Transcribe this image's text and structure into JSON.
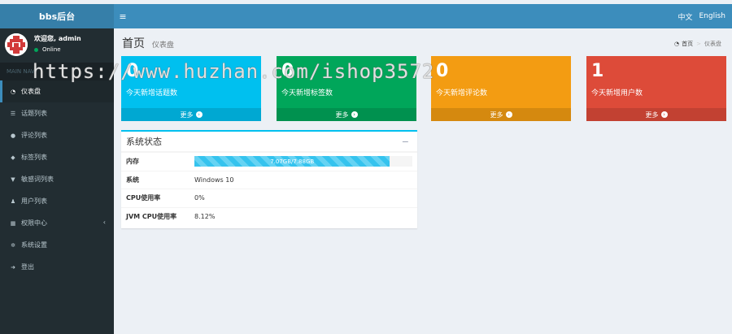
{
  "header": {
    "logo": "bbs后台",
    "toggle_icon": "≡",
    "lang_zh": "中文",
    "lang_en": "English"
  },
  "sidebar": {
    "welcome": "欢迎您, admin",
    "status": "Online",
    "section": "MAIN NAV",
    "items": [
      {
        "label": "仪表盘",
        "icon": "dashboard-icon"
      },
      {
        "label": "话题列表",
        "icon": "list-icon"
      },
      {
        "label": "评论列表",
        "icon": "comment-icon"
      },
      {
        "label": "标签列表",
        "icon": "tag-icon"
      },
      {
        "label": "敏感词列表",
        "icon": "filter-icon"
      },
      {
        "label": "用户列表",
        "icon": "user-icon"
      },
      {
        "label": "权限中心",
        "icon": "grid-icon"
      },
      {
        "label": "系统设置",
        "icon": "gears-icon"
      },
      {
        "label": "登出",
        "icon": "signout-icon"
      }
    ]
  },
  "watermark": "https://www.huzhan.com/ishop3572",
  "page": {
    "title": "首页",
    "subtitle": "仪表盘",
    "breadcrumb_home": "首页",
    "breadcrumb_current": "仪表盘"
  },
  "stats": [
    {
      "number": "0",
      "label": "今天新增话题数",
      "more": "更多",
      "color": "#00c0ef"
    },
    {
      "number": "0",
      "label": "今天新增标签数",
      "more": "更多",
      "color": "#00a65a"
    },
    {
      "number": "0",
      "label": "今天新增评论数",
      "more": "更多",
      "color": "#f39c12"
    },
    {
      "number": "1",
      "label": "今天新增用户数",
      "more": "更多",
      "color": "#dd4b39"
    }
  ],
  "system_status": {
    "title": "系统状态",
    "collapse": "−",
    "memory_label": "内存",
    "memory_text": "7.07GB/7.88GB",
    "memory_used_fraction": 0.897,
    "os_label": "系统",
    "os_value": "Windows 10",
    "cpu_label": "CPU使用率",
    "cpu_value": "0%",
    "jvm_label": "JVM CPU使用率",
    "jvm_value": "8.12%"
  }
}
